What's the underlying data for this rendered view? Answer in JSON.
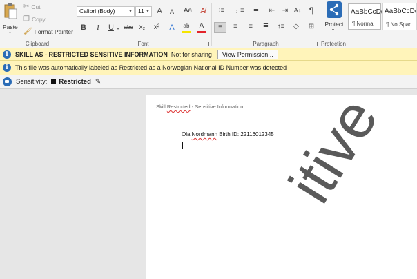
{
  "ribbon": {
    "clipboard": {
      "label": "Clipboard",
      "paste": "Paste",
      "cut": "Cut",
      "copy": "Copy",
      "format_painter": "Format Painter"
    },
    "font": {
      "label": "Font",
      "font_name": "Calibri (Body)",
      "font_size": "11",
      "grow": "A",
      "shrink": "A",
      "change_case": "Aa",
      "bold": "B",
      "italic": "I",
      "underline": "U",
      "strikethrough": "abc",
      "subscript": "x₂",
      "superscript": "x²",
      "text_effects": "A",
      "highlight": "ab",
      "font_color": "A"
    },
    "paragraph": {
      "label": "Paragraph"
    },
    "protection": {
      "label": "Protection",
      "protect": "Protect"
    },
    "styles": [
      {
        "sample": "AaBbCcDd",
        "name": "¶ Normal",
        "selected": true
      },
      {
        "sample": "AaBbCcDd",
        "name": "¶ No Spac...",
        "selected": false
      }
    ]
  },
  "infobars": [
    {
      "bold_text": "SKILL AS - RESTRICTED SENSITIVE INFORMATION",
      "text": "Not for sharing",
      "button": "View Permission..."
    },
    {
      "text": "This file was automatically labeled as Restricted as a Norwegian National ID Number was detected"
    }
  ],
  "sensitivity": {
    "label": "Sensitivity:",
    "value": "Restricted"
  },
  "document": {
    "header_prefix": "Skill ",
    "header_flagged": "Restricted",
    "header_suffix": " - Sensitive Information",
    "body_prefix": "Ola ",
    "body_flagged": "Nordmann",
    "body_suffix": " Birth ID: 22116012345",
    "watermark": "itive"
  },
  "colors": {
    "highlight": "#f5e500",
    "font_color": "#e3242b",
    "accent": "#2b6cb6",
    "infobar_bg": "#fff4ba"
  }
}
